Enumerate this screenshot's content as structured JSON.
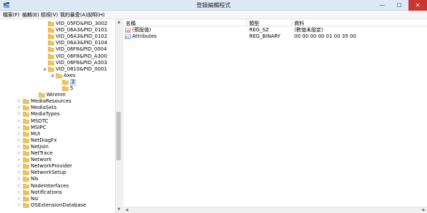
{
  "window": {
    "title": "登錄編輯程式",
    "minimize": "—",
    "maximize": "☐",
    "close": "✕"
  },
  "menu": [
    "檔案(F)",
    "編輯(E)",
    "檢視(V)",
    "我的最愛(A)",
    "說明(H)"
  ],
  "tree": [
    {
      "label": "VID_05FD&PID_3002",
      "level": 3,
      "arrow": ""
    },
    {
      "label": "VID_06A3&PID_0101",
      "level": 3,
      "arrow": ""
    },
    {
      "label": "VID_06A3&PID_0102",
      "level": 3,
      "arrow": ""
    },
    {
      "label": "VID_06A3&PID_0104",
      "level": 3,
      "arrow": ""
    },
    {
      "label": "VID_06F8&PID_0004",
      "level": 3,
      "arrow": ""
    },
    {
      "label": "VID_06F8&PID_A300",
      "level": 3,
      "arrow": ""
    },
    {
      "label": "VID_06F8&PID_A303",
      "level": 3,
      "arrow": ""
    },
    {
      "label": "VID_0810&PID_0001",
      "level": 3,
      "arrow": "◢"
    },
    {
      "label": "Axes",
      "level": 4,
      "arrow": "◢"
    },
    {
      "label": "2",
      "level": 5,
      "arrow": "",
      "selected": true
    },
    {
      "label": "5",
      "level": 5,
      "arrow": ""
    },
    {
      "label": "Winmm",
      "level": 2,
      "arrow": ""
    },
    {
      "label": "MediaResources",
      "level": 1,
      "arrow": "▷"
    },
    {
      "label": "MediaSets",
      "level": 1,
      "arrow": "▷"
    },
    {
      "label": "MediaTypes",
      "level": 1,
      "arrow": "▷"
    },
    {
      "label": "MSDTC",
      "level": 1,
      "arrow": "▷"
    },
    {
      "label": "MSIPC",
      "level": 1,
      "arrow": "▷"
    },
    {
      "label": "MUI",
      "level": 1,
      "arrow": "▷"
    },
    {
      "label": "NetDiagFx",
      "level": 1,
      "arrow": "▷"
    },
    {
      "label": "Netjoin",
      "level": 1,
      "arrow": "▷"
    },
    {
      "label": "NetTrace",
      "level": 1,
      "arrow": "▷"
    },
    {
      "label": "Network",
      "level": 1,
      "arrow": "▷"
    },
    {
      "label": "NetworkProvider",
      "level": 1,
      "arrow": "▷"
    },
    {
      "label": "NetworkSetup",
      "level": 1,
      "arrow": "▷"
    },
    {
      "label": "Nls",
      "level": 1,
      "arrow": "▷"
    },
    {
      "label": "NodeInterfaces",
      "level": 1,
      "arrow": "▷"
    },
    {
      "label": "Notifications",
      "level": 1,
      "arrow": "▷"
    },
    {
      "label": "Nsi",
      "level": 1,
      "arrow": "▷"
    },
    {
      "label": "OSExtensionDatabase",
      "level": 1,
      "arrow": "▷"
    }
  ],
  "list": {
    "headers": {
      "name": "名稱",
      "type": "類型",
      "data": "資料"
    },
    "rows": [
      {
        "icon": "string-value-icon",
        "name": "(預設值)",
        "type": "REG_SZ",
        "data": "(數值未設定)"
      },
      {
        "icon": "binary-value-icon",
        "name": "Attributes",
        "type": "REG_BINARY",
        "data": "00 00 00 00 01 00 35 00"
      }
    ]
  },
  "colors": {
    "titlebar": "#dfe9f5",
    "close_button": "#c7372f",
    "selection": "#cde8ff",
    "folder": "#e8c462"
  }
}
